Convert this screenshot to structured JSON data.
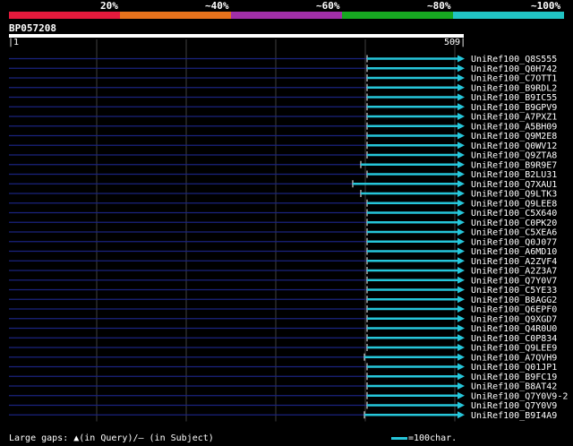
{
  "scale": {
    "labels": [
      "20%",
      "~40%",
      "~60%",
      "~80%",
      "~100%"
    ],
    "colors": [
      "#e31a3c",
      "#e8731c",
      "#a12fa8",
      "#17a821",
      "#21c4c4"
    ]
  },
  "query": {
    "name": "BP057208",
    "start": "1",
    "end": "509"
  },
  "colors": {
    "background": "#000000",
    "grid": "#404040",
    "gap_line": "#1a237e",
    "hit": "#26c6da"
  },
  "hits": [
    {
      "name": "UniRef100_Q8S555",
      "start": 401
    },
    {
      "name": "UniRef100_Q0H742",
      "start": 401
    },
    {
      "name": "UniRef100_C7OTT1",
      "start": 401
    },
    {
      "name": "UniRef100_B9RDL2",
      "start": 401
    },
    {
      "name": "UniRef100_B9IC55",
      "start": 401
    },
    {
      "name": "UniRef100_B9GPV9",
      "start": 401
    },
    {
      "name": "UniRef100_A7PXZ1",
      "start": 401
    },
    {
      "name": "UniRef100_A5BH09",
      "start": 401
    },
    {
      "name": "UniRef100_Q9M2E8",
      "start": 401
    },
    {
      "name": "UniRef100_Q0WV12",
      "start": 401
    },
    {
      "name": "UniRef100_Q9ZTA8",
      "start": 401
    },
    {
      "name": "UniRef100_B9R9E7",
      "start": 394
    },
    {
      "name": "UniRef100_B2LU31",
      "start": 401
    },
    {
      "name": "UniRef100_Q7XAU1",
      "start": 385
    },
    {
      "name": "UniRef100_Q9LTK3",
      "start": 394
    },
    {
      "name": "UniRef100_Q9LEE8",
      "start": 401
    },
    {
      "name": "UniRef100_C5X640",
      "start": 401
    },
    {
      "name": "UniRef100_C0PK20",
      "start": 401
    },
    {
      "name": "UniRef100_C5XEA6",
      "start": 401
    },
    {
      "name": "UniRef100_Q0J077",
      "start": 401
    },
    {
      "name": "UniRef100_A6MD10",
      "start": 401
    },
    {
      "name": "UniRef100_A2ZVF4",
      "start": 401
    },
    {
      "name": "UniRef100_A2Z3A7",
      "start": 401
    },
    {
      "name": "UniRef100_Q7Y0V7",
      "start": 401
    },
    {
      "name": "UniRef100_C5YE33",
      "start": 401
    },
    {
      "name": "UniRef100_B8AGG2",
      "start": 401
    },
    {
      "name": "UniRef100_Q6EPF0",
      "start": 401
    },
    {
      "name": "UniRef100_Q9XGD7",
      "start": 401
    },
    {
      "name": "UniRef100_Q4R0U0",
      "start": 401
    },
    {
      "name": "UniRef100_C0P834",
      "start": 401
    },
    {
      "name": "UniRef100_Q9LEE9",
      "start": 401
    },
    {
      "name": "UniRef100_A7QVH9",
      "start": 398
    },
    {
      "name": "UniRef100_Q01JP1",
      "start": 401
    },
    {
      "name": "UniRef100_B9FC19",
      "start": 401
    },
    {
      "name": "UniRef100_B8AT42",
      "start": 401
    },
    {
      "name": "UniRef100_Q7Y0V9-2",
      "start": 401
    },
    {
      "name": "UniRef100_Q7Y0V9",
      "start": 401
    },
    {
      "name": "UniRef100_B9I4A9",
      "start": 398
    }
  ],
  "footer": {
    "gaps_text": "Large gaps: ▲(in Query)/— (in Subject)",
    "legend_text": "=100char."
  }
}
